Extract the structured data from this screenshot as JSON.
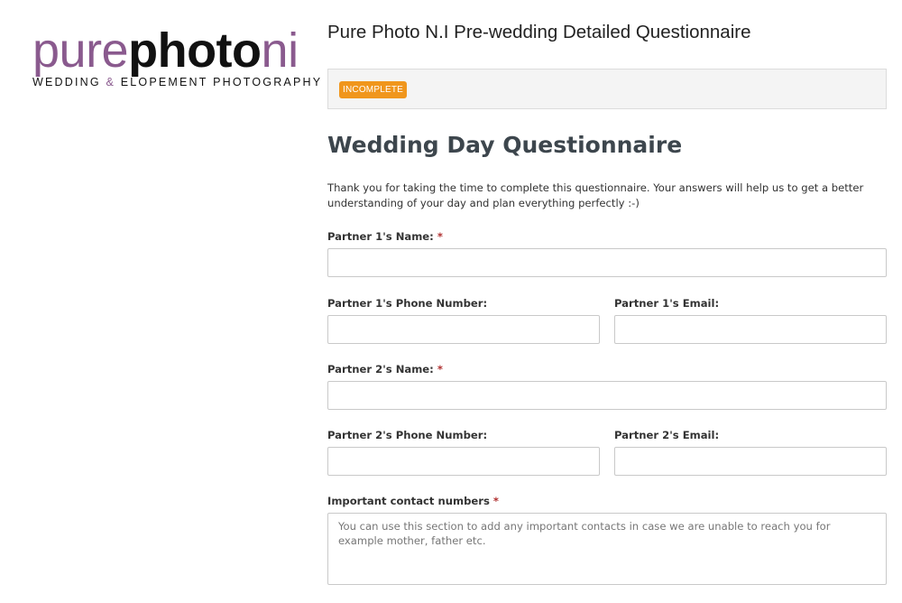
{
  "logo": {
    "part1": "pure",
    "part2": "photo",
    "part3": "ni",
    "tagline_before": "WEDDING ",
    "tagline_amp": "&",
    "tagline_after": " ELOPEMENT PHOTOGRAPHY"
  },
  "page_title": "Pure Photo N.I Pre-wedding Detailed Questionnaire",
  "status_badge": "INCOMPLETE",
  "form": {
    "heading": "Wedding Day Questionnaire",
    "intro": "Thank you for taking the time to complete this questionnaire. Your answers will help us to get a better understanding of your day and plan everything perfectly :-)",
    "required_marker": "*",
    "fields": {
      "p1_name": {
        "label": "Partner 1's Name:",
        "value": ""
      },
      "p1_phone": {
        "label": "Partner 1's Phone Number:",
        "value": ""
      },
      "p1_email": {
        "label": "Partner 1's Email:",
        "value": ""
      },
      "p2_name": {
        "label": "Partner 2's Name:",
        "value": ""
      },
      "p2_phone": {
        "label": "Partner 2's Phone Number:",
        "value": ""
      },
      "p2_email": {
        "label": "Partner 2's Email:",
        "value": ""
      },
      "contacts": {
        "label": "Important contact numbers",
        "placeholder": "You can use this section to add any important contacts in case we are unable to reach you for example mother, father etc."
      }
    }
  },
  "colors": {
    "brand_purple": "#8a5a8e",
    "badge_orange": "#f0961c",
    "required_red": "#b03030"
  }
}
